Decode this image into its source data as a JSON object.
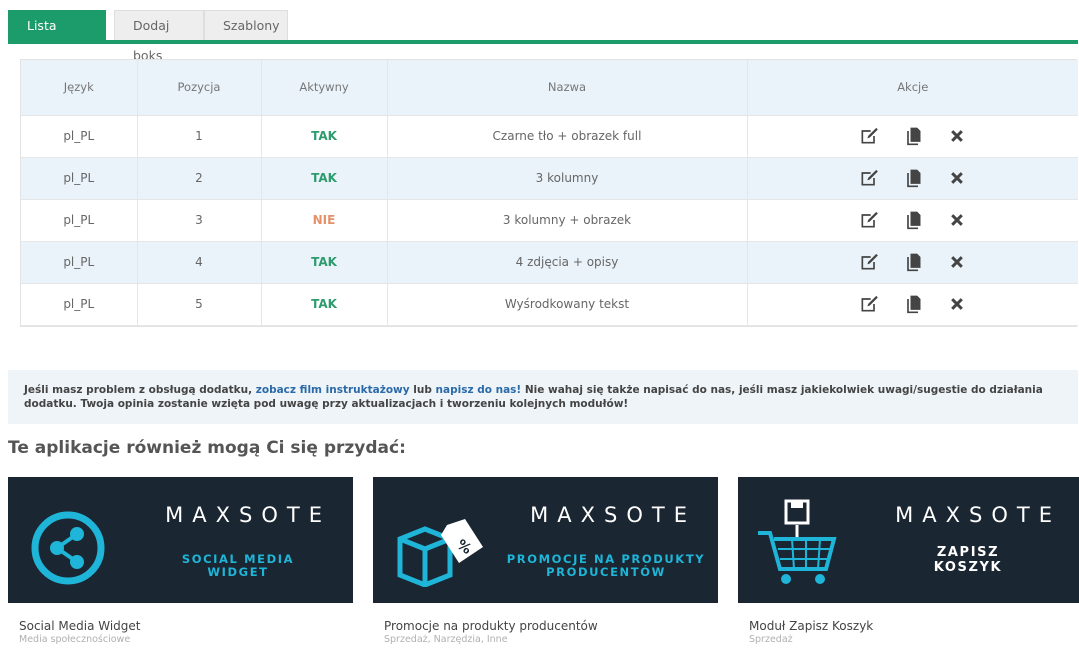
{
  "tabs": [
    {
      "label": "Lista boksów",
      "active": true
    },
    {
      "label": "Dodaj boks",
      "active": false
    },
    {
      "label": "Szablony",
      "active": false
    }
  ],
  "table": {
    "headers": [
      "Język",
      "Pozycja",
      "Aktywny",
      "Nazwa",
      "Akcje"
    ],
    "rows": [
      {
        "lang": "pl_PL",
        "pos": "1",
        "active": "TAK",
        "name": "Czarne tło + obrazek full"
      },
      {
        "lang": "pl_PL",
        "pos": "2",
        "active": "TAK",
        "name": "3 kolumny"
      },
      {
        "lang": "pl_PL",
        "pos": "3",
        "active": "NIE",
        "name": "3 kolumny + obrazek"
      },
      {
        "lang": "pl_PL",
        "pos": "4",
        "active": "TAK",
        "name": "4 zdjęcia + opisy"
      },
      {
        "lang": "pl_PL",
        "pos": "5",
        "active": "TAK",
        "name": "Wyśrodkowany tekst"
      }
    ],
    "action_icons": [
      "edit-icon",
      "copy-icon",
      "delete-icon"
    ]
  },
  "info": {
    "text1": "Jeśli masz problem z obsługą dodatku, ",
    "link1": "zobacz film instruktażowy",
    "text2": " lub ",
    "link2": "napisz do nas!",
    "text3": " Nie wahaj się także napisać do nas, jeśli masz jakiekolwiek uwagi/sugestie do działania dodatku. Twoja opinia zostanie wzięta pod uwagę przy aktualizacjach i tworzeniu kolejnych modułów!"
  },
  "apps_title": "Te aplikacje również mogą Ci się przydać:",
  "apps": [
    {
      "brand": "MAXSOTE",
      "banner_line1": "SOCIAL MEDIA",
      "banner_line2": "WIDGET",
      "name": "Social Media Widget",
      "category": "Media społecznościowe",
      "icon": "share-icon"
    },
    {
      "brand": "MAXSOTE",
      "banner_line1": "PROMOCJE NA PRODUKTY",
      "banner_line2": "PRODUCENTÓW",
      "name": "Promocje na produkty producentów",
      "category": "Sprzedaż, Narzędzia, Inne",
      "icon": "box-tag-icon"
    },
    {
      "brand": "MAXSOTE",
      "banner_line1": "ZAPISZ",
      "banner_line2": "KOSZYK",
      "name": "Moduł Zapisz Koszyk",
      "category": "Sprzedaż",
      "icon": "cart-save-icon"
    }
  ],
  "colors": {
    "accent": "#1d9c6b",
    "yes": "#2e9b6e",
    "no": "#e6906a",
    "link": "#2b6aa8",
    "banner_bg": "#1a2631",
    "banner_text": "#1fb5d8"
  }
}
